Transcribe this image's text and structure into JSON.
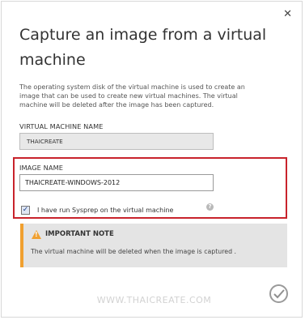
{
  "dialog": {
    "title": "Capture an image from a virtual machine",
    "description": "The operating system disk of the virtual machine is used to create an image that can be used to create new virtual machines. The virtual machine will be deleted after the image has been captured.",
    "close_icon": "close-icon"
  },
  "vm_name": {
    "label": "VIRTUAL MACHINE NAME",
    "value": "THAICREATE"
  },
  "image_name": {
    "label": "IMAGE NAME",
    "value": "THAICREATE-WINDOWS-2012"
  },
  "sysprep": {
    "checked": true,
    "label": "I have run Sysprep on the virtual machine",
    "help_icon": "question-icon"
  },
  "note": {
    "title": "IMPORTANT NOTE",
    "text": "The virtual machine will be deleted when the image is captured .",
    "icon": "warning-icon"
  },
  "watermark": "WWW.THAICREATE.COM",
  "colors": {
    "highlight_border": "#c8232c",
    "note_accent": "#f0a030",
    "note_background": "#e4e4e4"
  }
}
